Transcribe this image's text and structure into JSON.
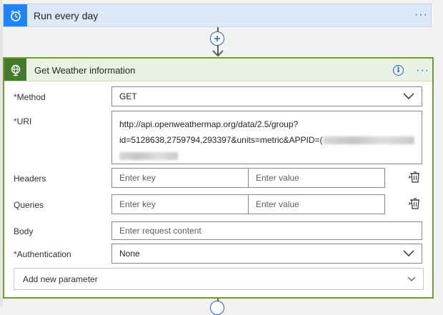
{
  "trigger": {
    "title": "Run every day",
    "icon": "alarm-clock-icon",
    "more_icon": "ellipsis-icon"
  },
  "connector": {
    "add_icon": "plus-icon",
    "arrow_icon": "arrow-down-icon"
  },
  "action": {
    "title": "Get Weather information",
    "icon": "globe-icon",
    "info_icon": "info-icon",
    "more_icon": "ellipsis-icon"
  },
  "form": {
    "method": {
      "label": "Method",
      "required": true,
      "value": "GET"
    },
    "uri": {
      "label": "URI",
      "required": true,
      "line1": "http://api.openweathermap.org/data/2.5/group?",
      "line2": "id=5128638,2759794,293397&units=metric&APPID=("
    },
    "headers": {
      "label": "Headers",
      "key_placeholder": "Enter key",
      "value_placeholder": "Enter value"
    },
    "queries": {
      "label": "Queries",
      "key_placeholder": "Enter key",
      "value_placeholder": "Enter value"
    },
    "body": {
      "label": "Body",
      "placeholder": "Enter request content"
    },
    "authentication": {
      "label": "Authentication",
      "required": true,
      "value": "None"
    },
    "add_parameter": {
      "label": "Add new parameter"
    }
  },
  "required_marker": "*",
  "colors": {
    "trigger_accent": "#1f85ff",
    "action_accent": "#457a2c",
    "action_border": "#6d9a3a",
    "link": "#1f5fc5",
    "required": "#c50f1f"
  }
}
